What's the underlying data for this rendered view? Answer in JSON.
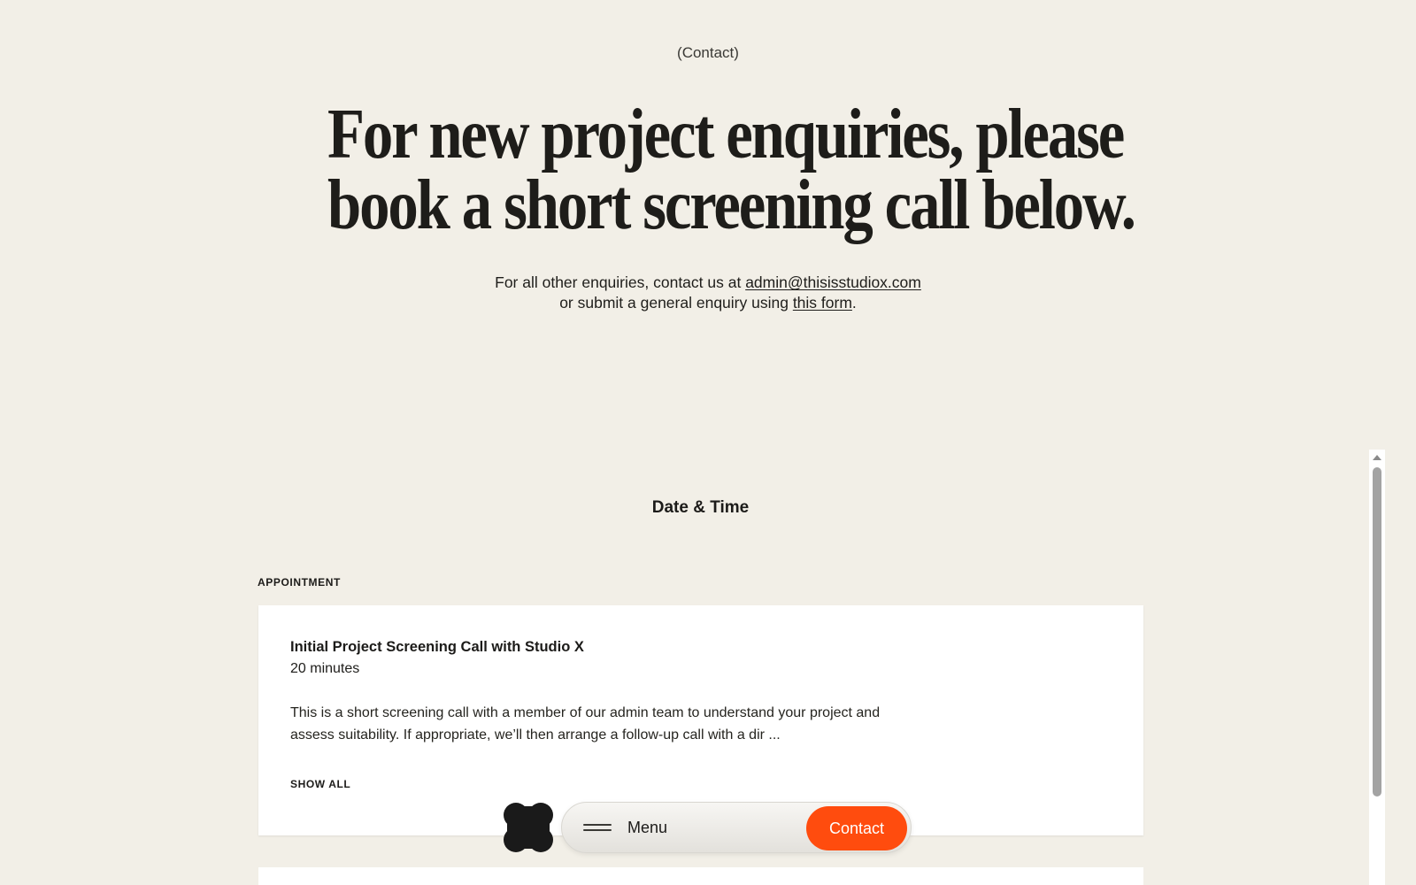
{
  "header": {
    "eyebrow": "(Contact)",
    "headline_line1": "For new project enquiries, please",
    "headline_line2": "book a short screening call below."
  },
  "intro": {
    "line1_prefix": "For all other enquiries, contact us at ",
    "email_link": "admin@thisisstudiox.com",
    "line2_prefix": "or submit a general enquiry using ",
    "form_link": "this form",
    "line2_suffix": "."
  },
  "booking": {
    "section_title": "Date & Time",
    "appointment_label": "APPOINTMENT",
    "card": {
      "title": "Initial Project Screening Call with Studio X",
      "duration": "20 minutes",
      "description": "This is a short screening call with a member of our admin team to understand your project and assess suitability. If appropriate, we’ll then arrange a follow-up call with a dir ...",
      "show_all_label": "SHOW ALL"
    }
  },
  "nav": {
    "logo_icon": "studio-x-logo-icon",
    "menu_icon": "hamburger-icon",
    "menu_label": "Menu",
    "contact_label": "Contact"
  },
  "colors": {
    "background": "#f2efe7",
    "accent": "#ff4c0e",
    "card": "#ffffff",
    "text": "#1c1b19"
  }
}
